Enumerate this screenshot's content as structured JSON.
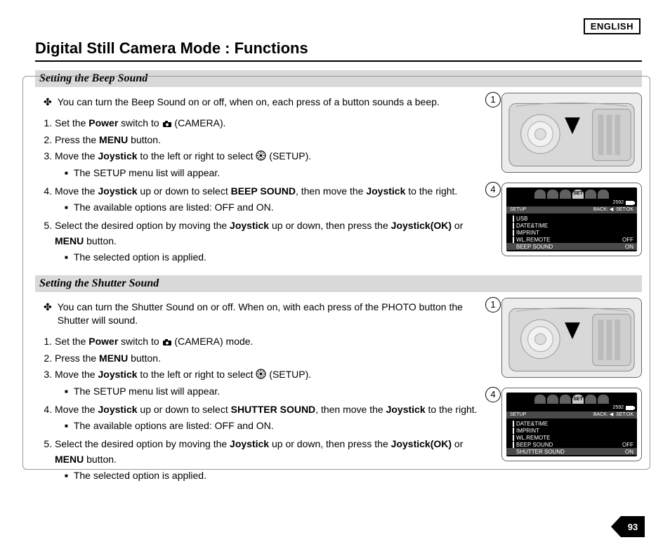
{
  "language_badge": "ENGLISH",
  "page_title": "Digital Still Camera Mode : Functions",
  "page_number": "93",
  "sections": [
    {
      "header": "Setting the Beep Sound",
      "intro": "You can turn the Beep Sound on or off, when on, each press of a button sounds a beep.",
      "steps": {
        "s1a": "Set the ",
        "s1b": "Power",
        "s1c": " switch to ",
        "s1d": " (CAMERA).",
        "s2a": "Press the ",
        "s2b": "MENU",
        "s2c": " button.",
        "s3a": "Move the ",
        "s3b": "Joystick",
        "s3c": " to the left or right to select ",
        "s3d": " (SETUP).",
        "s3sub": "The SETUP menu list will appear.",
        "s4a": "Move the ",
        "s4b": "Joystick",
        "s4c": " up or down to select ",
        "s4d": "BEEP SOUND",
        "s4e": ", then move the ",
        "s4f": "Joystick",
        "s4g": " to the right.",
        "s4sub": "The available options are listed: OFF and ON.",
        "s5a": "Select the desired option by moving the ",
        "s5b": "Joystick",
        "s5c": " up or down, then press the ",
        "s5d": "Joystick(OK)",
        "s5e": " or ",
        "s5f": "MENU",
        "s5g": " button.",
        "s5sub": "The selected option is applied."
      },
      "fig1_num": "1",
      "fig2_num": "4",
      "screen": {
        "tab_label": "SET",
        "resolution": "2592",
        "bar_left": "SETUP",
        "bar_back": "BACK:",
        "bar_set": "SET:OK",
        "rows": [
          "USB",
          "DATE&TIME",
          "IMPRINT",
          "WL.REMOTE",
          "BEEP SOUND"
        ],
        "opts": [
          "",
          "",
          "",
          "OFF",
          "ON"
        ]
      }
    },
    {
      "header": "Setting the Shutter Sound",
      "intro": "You can turn the Shutter Sound on or off. When on, with each press of the PHOTO button the Shutter will sound.",
      "steps": {
        "s1a": "Set the ",
        "s1b": "Power",
        "s1c": " switch to ",
        "s1d": " (CAMERA) mode.",
        "s2a": "Press the ",
        "s2b": "MENU",
        "s2c": " button.",
        "s3a": "Move the ",
        "s3b": "Joystick",
        "s3c": " to the left or right to select ",
        "s3d": " (SETUP).",
        "s3sub": "The SETUP menu list will appear.",
        "s4a": "Move the ",
        "s4b": "Joystick",
        "s4c": " up or down to select ",
        "s4d": "SHUTTER SOUND",
        "s4e": ", then move the ",
        "s4f": "Joystick",
        "s4g": " to the right.",
        "s4sub": "The available options are listed: OFF and ON.",
        "s5a": "Select the desired option by moving the ",
        "s5b": "Joystick",
        "s5c": " up or down, then press the ",
        "s5d": "Joystick(OK)",
        "s5e": " or ",
        "s5f": "MENU",
        "s5g": " button.",
        "s5sub": "The selected option is applied."
      },
      "fig1_num": "1",
      "fig2_num": "4",
      "screen": {
        "tab_label": "SET",
        "resolution": "2592",
        "bar_left": "SETUP",
        "bar_back": "BACK:",
        "bar_set": "SET:OK",
        "rows": [
          "DATE&TIME",
          "IMPRINT",
          "WL.REMOTE",
          "BEEP SOUND",
          "SHUTTER SOUND"
        ],
        "opts": [
          "",
          "",
          "",
          "OFF",
          "ON"
        ]
      }
    }
  ]
}
